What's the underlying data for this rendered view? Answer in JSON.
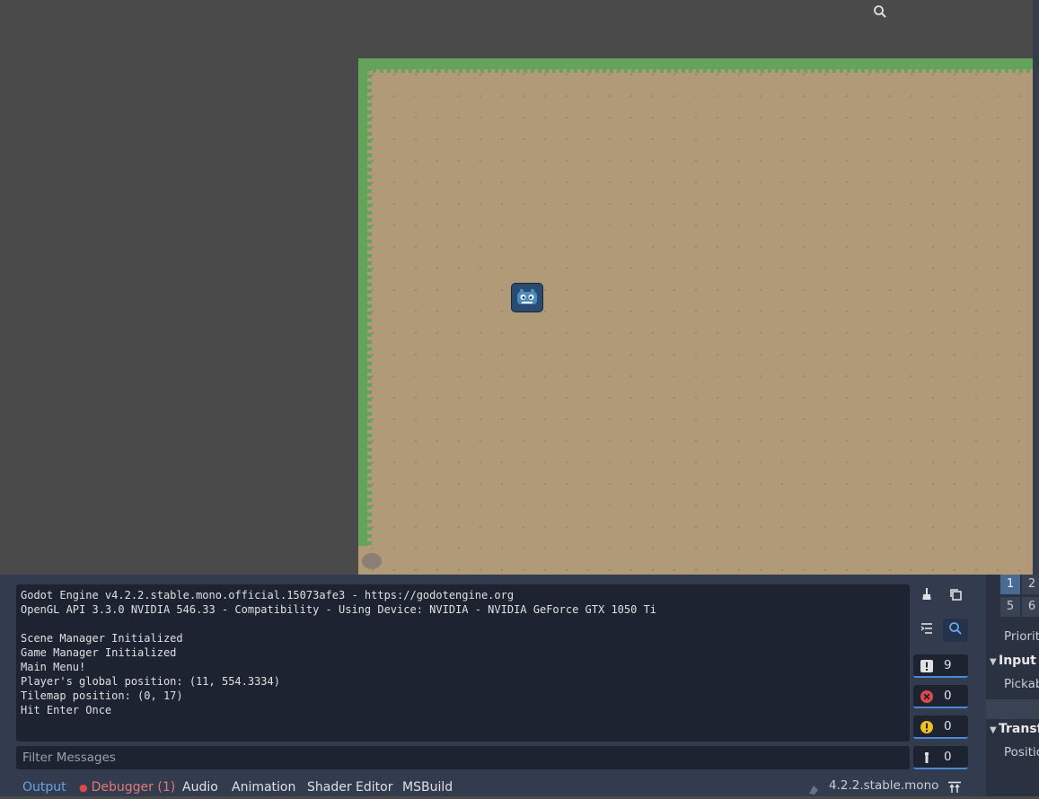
{
  "output": {
    "lines": [
      "Godot Engine v4.2.2.stable.mono.official.15073afe3 - https://godotengine.org",
      "OpenGL API 3.3.0 NVIDIA 546.33 - Compatibility - Using Device: NVIDIA - NVIDIA GeForce GTX 1050 Ti",
      "",
      "Scene Manager Initialized",
      "Game Manager Initialized",
      "Main Menu!",
      "Player's global position: (11, 554.3334)",
      "Tilemap position: (0, 17)",
      "Hit Enter Once"
    ]
  },
  "filter": {
    "placeholder": "Filter Messages"
  },
  "counters": {
    "messages": "9",
    "errors": "0",
    "warnings": "0",
    "editor": "0"
  },
  "tabs": {
    "output": "Output",
    "debugger": "Debugger (1)",
    "audio": "Audio",
    "animation": "Animation",
    "shader_editor": "Shader Editor",
    "msbuild": "MSBuild"
  },
  "version": "4.2.2.stable.mono",
  "inspector": {
    "layers": [
      "1",
      "2",
      "5",
      "6"
    ],
    "priority_label": "Priorit",
    "input_section": "Input",
    "pickable_label": "Pickab",
    "transform_section": "Transfo",
    "position_label": "Positio"
  },
  "colors": {
    "accent": "#4c88d6",
    "tab_active": "#6aa2e8",
    "error_red": "#e04848",
    "warning_yellow": "#f0c020",
    "grass": "#63a35a",
    "ground": "#b09a78"
  },
  "icons": {
    "clear": "broom-icon",
    "copy": "copy-icon",
    "collapse": "collapse-lines-icon",
    "search": "search-icon",
    "message": "message-icon",
    "error": "error-icon",
    "warning": "warning-icon",
    "editor": "editor-message-icon"
  }
}
